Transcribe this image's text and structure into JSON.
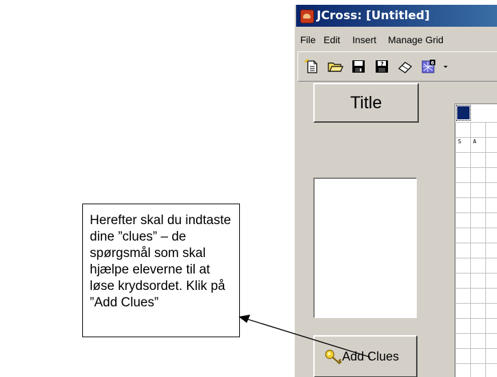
{
  "window": {
    "title": "JCross: [Untitled]"
  },
  "menu": {
    "items": [
      "File",
      "Edit",
      "Insert",
      "Manage Grid"
    ]
  },
  "toolbar": {
    "buttons": [
      "new-file-icon",
      "open-folder-icon",
      "save-icon",
      "save-as-icon",
      "eraser-icon",
      "export-web-icon"
    ]
  },
  "left_pane": {
    "title_button": "Title",
    "add_clues_button": "Add Clues"
  },
  "grid": {
    "letters": [
      "S",
      "A"
    ],
    "selected_color": "#0a246a"
  },
  "callout": {
    "lines": [
      "Herefter skal du indtaste",
      "dine ”clues” – de",
      "spørgsmål som skal",
      "hjælpe eleverne til at",
      "løse krydsordet. Klik på",
      "”Add Clues”"
    ]
  },
  "colors": {
    "titlebar_start": "#0a246a",
    "titlebar_end": "#3a6ea5",
    "face": "#d4d0c8"
  }
}
